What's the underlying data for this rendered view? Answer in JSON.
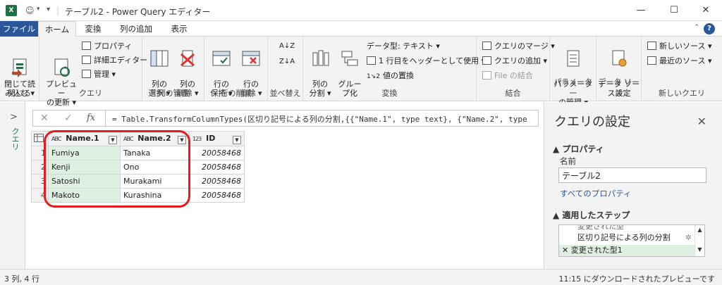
{
  "window": {
    "app_icon": "X",
    "title": "テーブル2 - Power Query エディター",
    "minimize": "—",
    "maximize": "☐",
    "close": "✕"
  },
  "tabs": [
    "ファイル",
    "ホーム",
    "変換",
    "列の追加",
    "表示"
  ],
  "ribbon": {
    "close_group": {
      "btn": "閉じて読\nみ込む ▾",
      "label": "閉じる"
    },
    "query_group": {
      "preview": "プレビュー\nの更新 ▾",
      "properties": "プロパティ",
      "advanced_editor": "詳細エディター",
      "manage": "管理 ▾",
      "label": "クエリ"
    },
    "columns_group": {
      "choose": "列の\n選択 ▾",
      "remove": "列の\n削除 ▾",
      "label": "列の管理"
    },
    "rows_group": {
      "keep": "行の\n保持 ▾",
      "remove": "行の\n削除 ▾",
      "label": "行の削減"
    },
    "sort_group": {
      "label": "並べ替え"
    },
    "transform_group": {
      "split": "列の\n分割 ▾",
      "group": "グルー\nプ化",
      "datatype": "データ型: テキスト ▾",
      "first_row": "1 行目をヘッダーとして使用 ▾",
      "replace": "値の置換",
      "label": "変換"
    },
    "combine_group": {
      "merge": "クエリのマージ ▾",
      "append": "クエリの追加 ▾",
      "files": "File の結合",
      "label": "結合"
    },
    "params_group": {
      "btn": "パラメーター\nの管理 ▾",
      "label": "パラメーター"
    },
    "datasource_group": {
      "btn": "データ ソー\nス設定",
      "label": "データ ソース"
    },
    "newquery_group": {
      "new_source": "新しいソース ▾",
      "recent": "最近のソース ▾",
      "label": "新しいクエリ"
    },
    "help": "?"
  },
  "left_pane": {
    "label": "クエリ"
  },
  "formula_bar": {
    "cancel": "✕",
    "commit": "✓",
    "fx": "fx",
    "formula": "= Table.TransformColumnTypes(区切り記号による列の分割,{{\"Name.1\", type text}, {\"Name.2\", type"
  },
  "grid": {
    "columns": [
      {
        "type": "ABC",
        "name": "Name.1"
      },
      {
        "type": "ABC",
        "name": "Name.2"
      },
      {
        "type": "123",
        "name": "ID"
      }
    ],
    "rows": [
      {
        "n": "1",
        "c1": "Fumiya",
        "c2": "Tanaka",
        "c3": "20058468"
      },
      {
        "n": "2",
        "c1": "Kenji",
        "c2": "Ono",
        "c3": "20058468"
      },
      {
        "n": "3",
        "c1": "Satoshi",
        "c2": "Murakami",
        "c3": "20058468"
      },
      {
        "n": "4",
        "c1": "Makoto",
        "c2": "Kurashina",
        "c3": "20058468"
      }
    ]
  },
  "settings": {
    "title": "クエリの設定",
    "close": "✕",
    "properties_header": "▲ プロパティ",
    "name_label": "名前",
    "name_value": "テーブル2",
    "all_properties": "すべてのプロパティ",
    "steps_header": "▲ 適用したステップ",
    "steps": [
      {
        "label": "変更された型",
        "active": false
      },
      {
        "label": "区切り記号による列の分割",
        "active": false
      },
      {
        "label": "✕ 変更された型1",
        "active": true
      }
    ],
    "gear": "✲"
  },
  "status": {
    "left": "3 列, 4 行",
    "right": "11:15 にダウンロードされたプレビューです"
  },
  "colors": {
    "accent": "#2b579a",
    "excel_green": "#1e7145",
    "selection": "#dff0e3",
    "callout": "#e21d1d"
  }
}
